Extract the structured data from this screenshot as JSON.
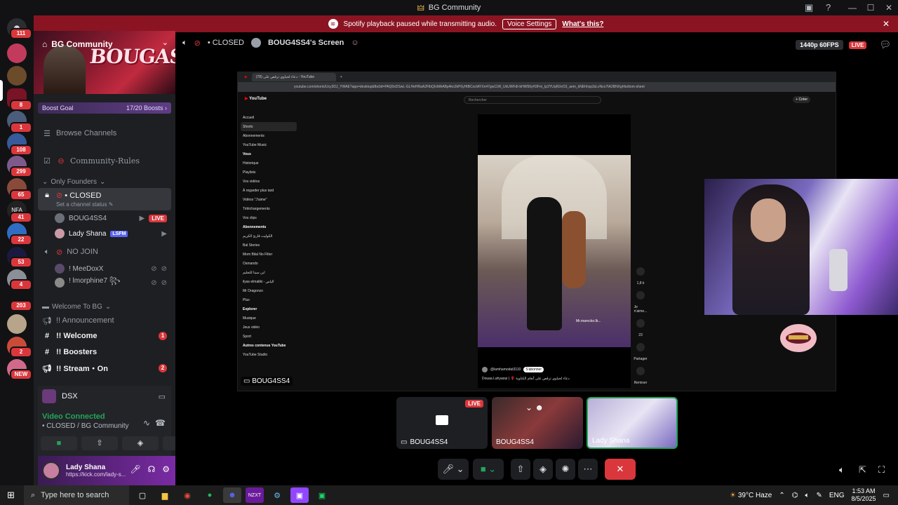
{
  "window": {
    "title": "BG Community"
  },
  "notice": {
    "text": "Spotify playback paused while transmitting audio.",
    "button": "Voice Settings",
    "link": "What's this?"
  },
  "rail": {
    "badges": [
      "111",
      "8",
      "1",
      "108",
      "299",
      "65",
      "41",
      "22",
      "53",
      "4",
      "203",
      "2",
      "NEW"
    ]
  },
  "sidebar": {
    "guild_name": "BG Community",
    "banner_word": "BOUGASSAA",
    "boost_goal": "Boost Goal",
    "boost_count": "17/20 Boosts",
    "browse_channels": "Browse Channels",
    "rules_channel": "Community-Rules",
    "category_founders": "Only Founders",
    "voice_closed": "• CLOSED",
    "voice_closed_status": "Set a channel status",
    "voice_users_closed": [
      {
        "name": "BOUG4SS4",
        "tag": "LIVE"
      },
      {
        "name": "Lady Shana",
        "tag": "LSFM"
      }
    ],
    "voice_nojoin": "NO JOIN",
    "voice_users_nojoin": [
      {
        "name": "! MeeDoxX"
      },
      {
        "name": "! lmorphine7 ꧂"
      }
    ],
    "category_welcome": "Welcome To BG",
    "channels": [
      {
        "name": "!! Announcement",
        "badge": ""
      },
      {
        "name": "!! Welcome",
        "badge": "1"
      },
      {
        "name": "!! Boosters",
        "badge": ""
      },
      {
        "name": "!! Stream・On",
        "badge": "2"
      }
    ]
  },
  "voice_panel": {
    "app_name": "DSX",
    "connected": "Video Connected",
    "location": "• CLOSED / BG Community",
    "user_name": "Lady Shana",
    "user_status": "https://kick.com/lady-s..."
  },
  "stage": {
    "channel": "• CLOSED",
    "screen_title": "BOUG4SS4's Screen",
    "quality": "1440p 60FPS",
    "live": "LIVE",
    "screen_tag": "BOUG4SS4"
  },
  "browser": {
    "tab_title": "دعاء لحياوي ترقص على (78) - YouTube",
    "url": "youtube.com/shorts/Ucy3DJ_YWAE?app=desktop&fbclid=PAQ0xDSwL-GLHeHRaA2FlbQIxMAABp4kn2kP0yHtBCxxIAYXn47gw11W_UkUWFdI-bHW56yH3Fm_Ip2YUqR2eO3_aem_kNEhhsp3sLvNco7tA2BNXg#bottom-sheet",
    "search_placeholder": "Rechercher",
    "create": "+ Créer",
    "nav": [
      "Accueil",
      "Shorts",
      "Abonnements",
      "YouTube Music"
    ],
    "you_header": "Vous",
    "you_items": [
      "Historique",
      "Playlists",
      "Vos vidéos",
      "À regarder plus tard",
      "Vidéos \"J'aime\"",
      "Téléchargements",
      "Vos clips"
    ],
    "subs_header": "Abonnements",
    "subs": [
      "الكوليت قارئ الكريم",
      "Bal Stories",
      "Mom Bilal No Filter",
      "Osmando",
      "ابن سينا للتعليم",
      "ilyas elmaliki - الياس",
      "Mr Dragonzo",
      "Plus"
    ],
    "explore_header": "Explorer",
    "explore": [
      "Musique",
      "Jeux vidéo",
      "Sport"
    ],
    "other_header": "Autres contenus YouTube",
    "other": [
      "YouTube Studio"
    ],
    "short_channel": "@lamhamodat3110",
    "subscribe": "S'abonner",
    "short_caption": "Douaa Lahyaoui | 🌹 دعاء لحياوي ترقص على أنغام الكناوية",
    "likes": "1,8 k",
    "dislike": "Je n'aime...",
    "comments": "23",
    "share": "Partager",
    "remix": "Remixer",
    "watermark": "Mr.marocko.lb..."
  },
  "tiles": [
    {
      "name": "BOUG4SS4",
      "live": "LIVE"
    },
    {
      "name": "BOUG4SS4",
      "live": ""
    },
    {
      "name": "Lady Shana",
      "live": ""
    }
  ],
  "taskbar": {
    "search_placeholder": "Type here to search",
    "weather": "39°C  Haze",
    "lang": "ENG",
    "time": "1:53 AM",
    "date": "8/5/2025"
  },
  "colors": {
    "accent": "#5865f2",
    "live": "#da373c",
    "green": "#23a55a",
    "notice": "#8b1422"
  }
}
